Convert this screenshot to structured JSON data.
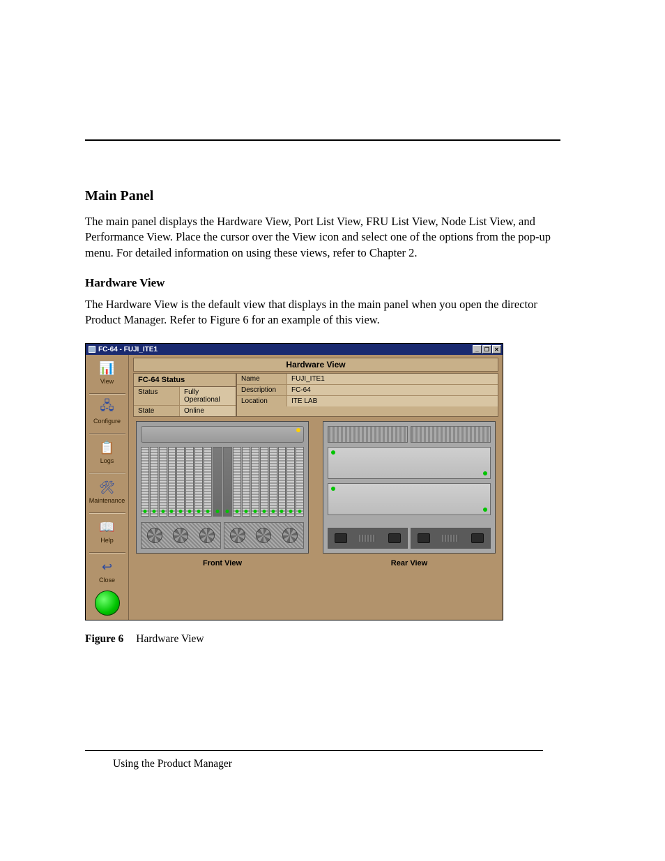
{
  "section": {
    "title": "Main Panel",
    "body": "The main panel displays the Hardware View, Port List View, FRU List View, Node List View, and Performance View. Place the cursor over the View icon and select one of the options from the pop-up menu. For detailed information on using these views, refer to Chapter 2."
  },
  "subsection": {
    "title": "Hardware View",
    "body": "The Hardware View is the default view that displays in the main panel when you open the director Product Manager. Refer to Figure 6 for an example of this view."
  },
  "window": {
    "title": "FC-64  - FUJI_ITE1",
    "view_title": "Hardware View",
    "status_header": "FC-64 Status",
    "left_rows": [
      {
        "key": "Status",
        "val": "Fully Operational"
      },
      {
        "key": "State",
        "val": "Online"
      }
    ],
    "right_rows": [
      {
        "key": "Name",
        "val": "FUJI_ITE1"
      },
      {
        "key": "Description",
        "val": "FC-64"
      },
      {
        "key": "Location",
        "val": "ITE LAB"
      }
    ],
    "sidebar": [
      {
        "label": "View",
        "glyph": "📊"
      },
      {
        "label": "Configure",
        "glyph": "🖧"
      },
      {
        "label": "Logs",
        "glyph": "📋"
      },
      {
        "label": "Maintenance",
        "glyph": "🛠"
      },
      {
        "label": "Help",
        "glyph": "📖"
      },
      {
        "label": "Close",
        "glyph": "↩"
      }
    ],
    "front_label": "Front View",
    "rear_label": "Rear View",
    "win_controls": {
      "min": "_",
      "max": "❐",
      "close": "✕"
    }
  },
  "caption": {
    "label": "Figure 6",
    "text": "Hardware View"
  },
  "footer": "Using the Product Manager"
}
